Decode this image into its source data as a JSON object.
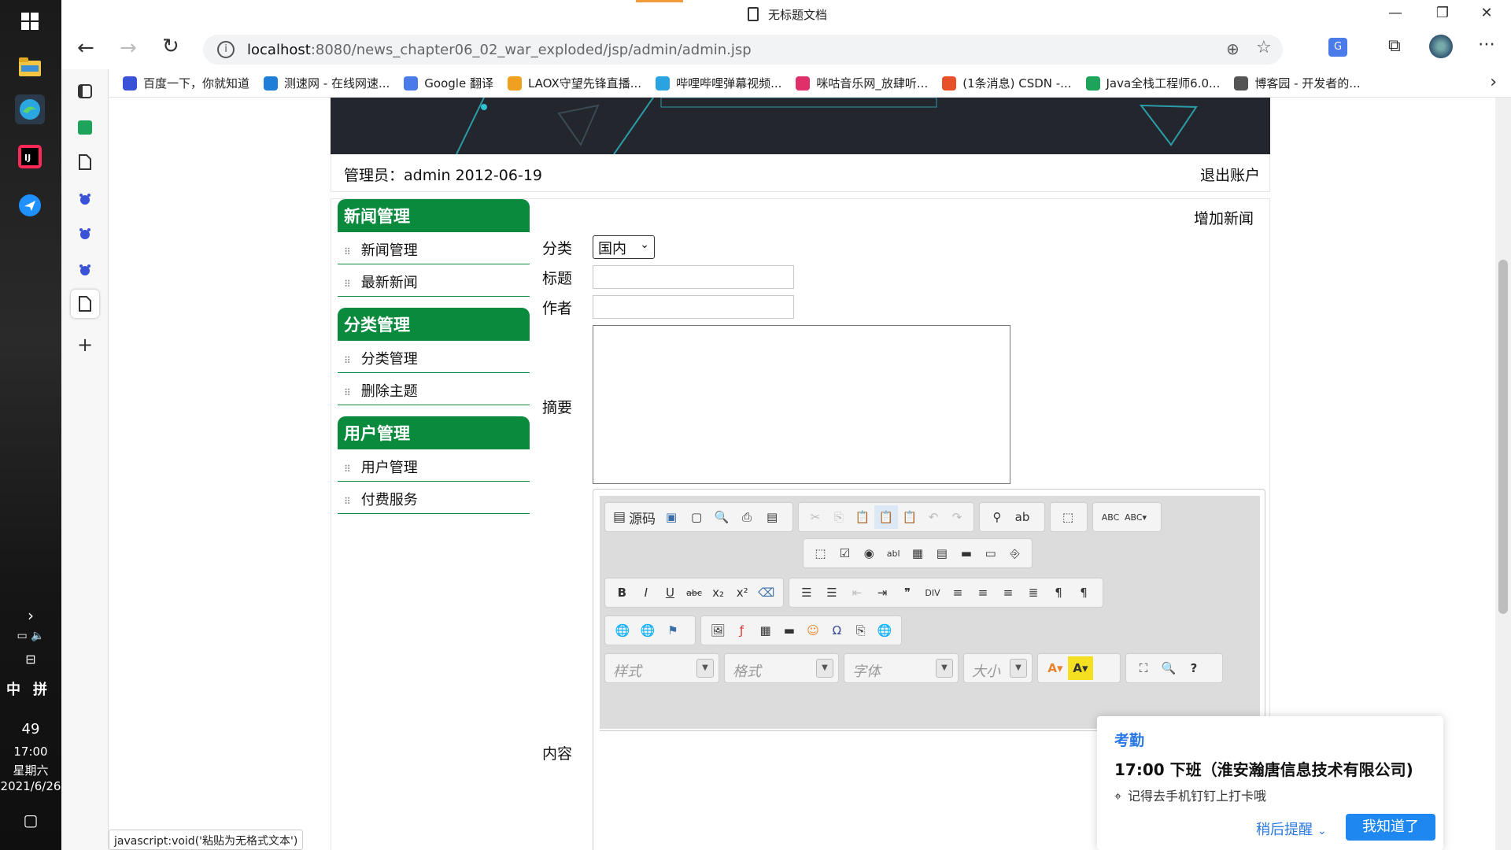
{
  "window": {
    "title": "无标题文档",
    "minimize": "—",
    "restore": "❐",
    "close": "✕"
  },
  "addressbar": {
    "url_host": "localhost",
    "url_path": ":8080/news_chapter06_02_war_exploded/jsp/admin/admin.jsp"
  },
  "bookmarks": [
    {
      "label": "百度一下，你就知道",
      "color": "#3a52d8"
    },
    {
      "label": "测速网 - 在线网速...",
      "color": "#1e7ed8"
    },
    {
      "label": "Google 翻译",
      "color": "#4a7be8"
    },
    {
      "label": "LAOX守望先锋直播...",
      "color": "#f0a020"
    },
    {
      "label": "哔哩哔哩弹幕视频...",
      "color": "#2aa4e0"
    },
    {
      "label": "咪咕音乐网_放肆听...",
      "color": "#e0306a"
    },
    {
      "label": "(1条消息) CSDN -...",
      "color": "#e8502a"
    },
    {
      "label": "Java全栈工程师6.0...",
      "color": "#1ea35a"
    },
    {
      "label": "博客园 - 开发者的...",
      "color": "#555555"
    }
  ],
  "taskbar": {
    "ime_lang": "中",
    "ime_mode": "拼",
    "weather": "49",
    "time": "17:00",
    "weekday": "星期六",
    "date": "2021/6/26"
  },
  "admin_bar": {
    "who": "管理员：admin 2012-06-19",
    "logout": "退出账户"
  },
  "nav": [
    {
      "head": "新闻管理",
      "items": [
        "新闻管理",
        "最新新闻"
      ]
    },
    {
      "head": "分类管理",
      "items": [
        "分类管理",
        "删除主题"
      ]
    },
    {
      "head": "用户管理",
      "items": [
        "用户管理",
        "付费服务"
      ]
    }
  ],
  "form": {
    "heading": "增加新闻",
    "category_label": "分类",
    "category_value": "国内",
    "title_label": "标题",
    "author_label": "作者",
    "summary_label": "摘要",
    "content_label": "内容"
  },
  "editor": {
    "source_label": "源码",
    "combo_style": "样式",
    "combo_format": "格式",
    "combo_font": "字体",
    "combo_size": "大小"
  },
  "statusbar": "javascript:void('粘贴为无格式文本')",
  "notification": {
    "title": "考勤",
    "main": "17:00 下班（淮安瀚唐信息技术有限公司)",
    "sub": "记得去手机钉钉上打卡哦",
    "later": "稍后提醒",
    "ok": "我知道了"
  },
  "colors": {
    "nav_green": "#0a8a3d",
    "accent_blue": "#1e88f0"
  }
}
